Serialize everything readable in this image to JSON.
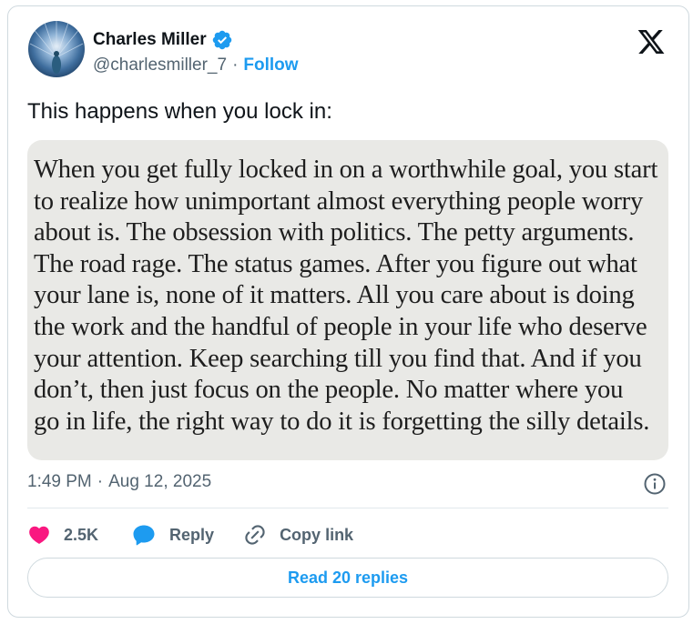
{
  "author": {
    "display_name": "Charles Miller",
    "handle": "@charlesmiller_7",
    "separator": "·",
    "follow_label": "Follow",
    "verified": true,
    "verified_color": "#1d9bf0"
  },
  "brand": {
    "logo_icon": "x-logo-icon"
  },
  "tweet": {
    "text": "This happens when you lock in:",
    "image_quote_lines": [
      "When you get fully locked in on a worthwhile goal, you start",
      "to realize how unimportant almost everything people worry",
      "about is. The obsession with politics. The petty arguments.",
      "The road rage. The status games. After you figure out what",
      "your lane is, none of it matters. All you care about is doing",
      "the work and the handful of people in your life who deserve",
      "your attention. Keep searching till you find that. And if you",
      "don’t, then just focus on the people. No matter where you",
      "go in life, the right way to do it is forgetting the silly details."
    ]
  },
  "meta": {
    "time": "1:49 PM",
    "separator": "·",
    "date": "Aug 12, 2025"
  },
  "actions": {
    "like_count": "2.5K",
    "reply_label": "Reply",
    "copy_link_label": "Copy link"
  },
  "footer": {
    "read_replies_label": "Read 20 replies"
  },
  "colors": {
    "accent": "#1d9bf0",
    "like": "#f91880",
    "muted_text": "#536471",
    "border": "#cfd9de",
    "media_bg": "#e9e9e6"
  }
}
